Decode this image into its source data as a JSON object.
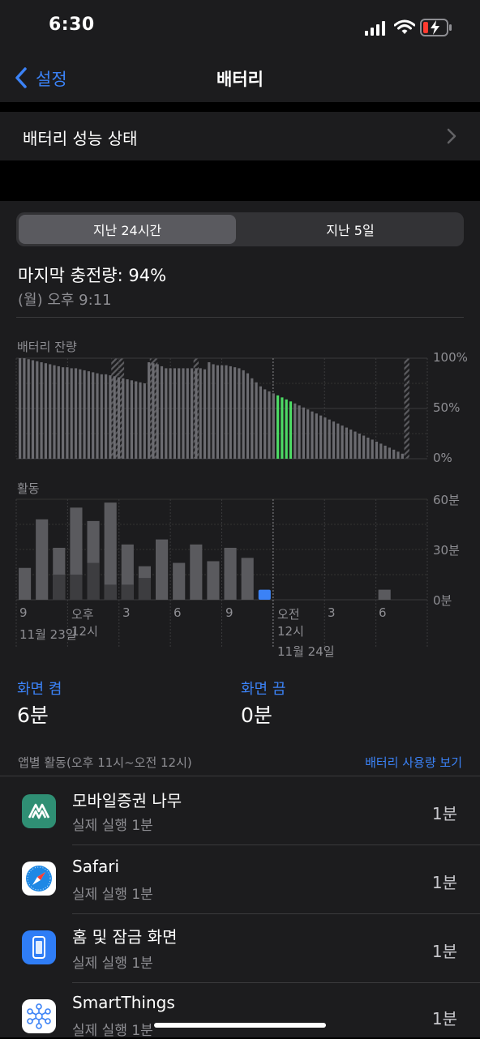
{
  "status": {
    "time": "6:30"
  },
  "nav": {
    "back_label": "설정",
    "title": "배터리"
  },
  "battery_health_row": {
    "label": "배터리 성능 상태"
  },
  "segments": {
    "active": "지난 24시간",
    "inactive": "지난 5일"
  },
  "last_charge": {
    "label": "마지막 충전량: 94%",
    "time": "(월) 오후 9:11"
  },
  "screen_on": {
    "label": "화면 켬",
    "value": "6분"
  },
  "screen_off": {
    "label": "화면 끔",
    "value": "0분"
  },
  "app_activity": {
    "header": "앱별 활동(오후 11시~오전 12시)",
    "link": "배터리 사용량 보기"
  },
  "apps": [
    {
      "name": "모바일증권 나무",
      "detail": "실제 실행 1분",
      "duration": "1분",
      "icon": "namuh-app-icon"
    },
    {
      "name": "Safari",
      "detail": "실제 실행 1분",
      "duration": "1분",
      "icon": "safari-compass-icon"
    },
    {
      "name": "홈 및 잠금 화면",
      "detail": "실제 실행 1분",
      "duration": "1분",
      "icon": "phone-screen-icon"
    },
    {
      "name": "SmartThings",
      "detail": "실제 실행 1분",
      "duration": "1분",
      "icon": "smartthings-hub-icon"
    }
  ],
  "chart_data": [
    {
      "type": "bar",
      "title": "배터리 잔량",
      "y_ticks": [
        "100%",
        "50%",
        "0%"
      ],
      "ylim": [
        0,
        100
      ],
      "values": [
        100,
        100,
        99,
        98,
        97,
        96,
        95,
        94,
        93,
        92,
        91,
        91,
        90,
        90,
        89,
        88,
        87,
        86,
        85,
        84,
        84,
        83,
        82,
        81,
        80,
        79,
        78,
        77,
        76,
        75,
        96,
        95,
        94,
        92,
        90,
        90,
        90,
        90,
        90,
        90,
        90,
        90,
        90,
        89,
        96,
        94,
        93,
        93,
        93,
        92,
        91,
        90,
        88,
        85,
        80,
        76,
        72,
        69,
        67,
        65,
        63,
        61,
        59,
        57,
        55,
        53,
        51,
        49,
        47,
        45,
        43,
        41,
        39,
        37,
        35,
        33,
        31,
        29,
        27,
        25,
        23,
        21,
        19,
        17,
        15,
        13,
        11,
        9,
        7,
        5
      ],
      "charging_indices": [
        60,
        61,
        62,
        63
      ],
      "charger_connected_bands": [
        [
          37,
          42
        ],
        [
          52,
          55
        ],
        [
          69,
          71
        ],
        [
          151,
          153
        ]
      ]
    },
    {
      "type": "bar",
      "title": "활동",
      "y_ticks": [
        "60분",
        "30분",
        "0분"
      ],
      "ylim": [
        0,
        60
      ],
      "categories": [
        "9",
        "",
        "",
        "오후 12시",
        "",
        "",
        "3",
        "",
        "",
        "6",
        "",
        "",
        "9",
        "",
        "",
        "오전 12시",
        "",
        "",
        "3",
        "",
        "",
        "6",
        "",
        ""
      ],
      "series": [
        {
          "name": "화면 켬",
          "values": [
            19,
            48,
            31,
            55,
            47,
            58,
            33,
            20,
            36,
            22,
            33,
            23,
            31,
            25,
            6,
            0,
            0,
            0,
            0,
            0,
            0,
            6,
            0,
            0
          ]
        },
        {
          "name": "화면 끔",
          "values": [
            0,
            0,
            15,
            15,
            22,
            9,
            9,
            13,
            0,
            0,
            0,
            0,
            0,
            0,
            0,
            0,
            0,
            0,
            0,
            0,
            0,
            0,
            0,
            0
          ]
        }
      ],
      "x_labels": [
        {
          "top": "9",
          "bottom": "11월 23일"
        },
        {
          "top": "오후",
          "bottom": "12시"
        },
        {
          "top": "3",
          "bottom": ""
        },
        {
          "top": "6",
          "bottom": ""
        },
        {
          "top": "9",
          "bottom": ""
        },
        {
          "top": "오전",
          "bottom": "12시"
        },
        {
          "top": "3",
          "bottom": ""
        },
        {
          "top": "6",
          "bottom": ""
        }
      ],
      "date_label_2": "11월 24일"
    }
  ],
  "colors": {
    "accent": "#3b82f6",
    "charging": "#4cd964",
    "bar": "#6b6b70",
    "background_card": "#1c1c1e"
  }
}
